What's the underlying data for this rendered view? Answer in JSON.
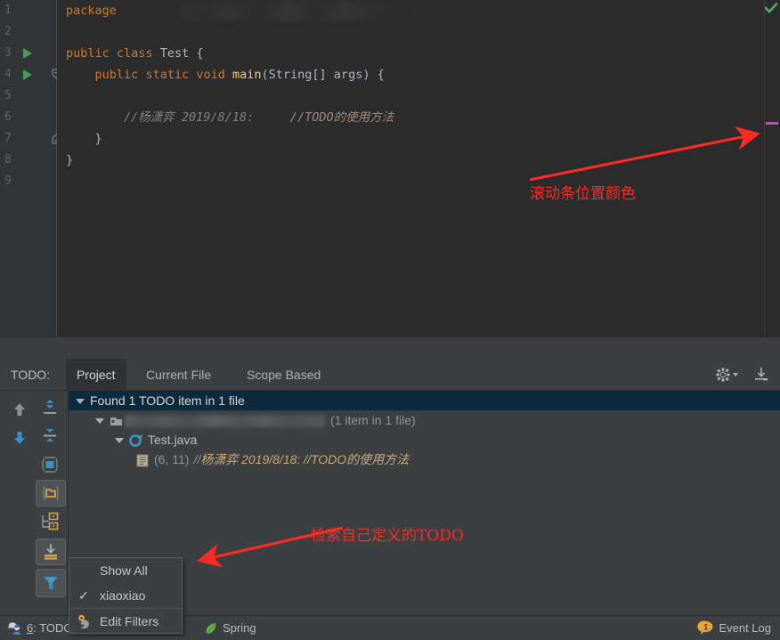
{
  "editor": {
    "line_numbers": [
      "1",
      "2",
      "3",
      "4",
      "5",
      "6",
      "7",
      "8",
      "9"
    ],
    "code": {
      "l1_package": "package",
      "l3": "public class Test {",
      "l3_kw1": "public",
      "l3_kw2": "class",
      "l3_name": "Test",
      "l3_brace": "{",
      "l4_kw1": "public",
      "l4_kw2": "static",
      "l4_kw3": "void",
      "l4_name": "main",
      "l4_args": "(String[] args) {",
      "l6_comment": "//杨潇弈 2019/8/18:",
      "l6_todo": "//TODO的使用方法",
      "l7": "}",
      "l8": "}"
    },
    "markers": {
      "inspection_ok_icon": "check-icon",
      "todo_stripe_color": "#cc44cc"
    }
  },
  "annotations": [
    {
      "text": "滚动条位置颜色",
      "color": "#ff2a24"
    },
    {
      "text": "检索自己定义的TODO",
      "color": "#ff2a24"
    }
  ],
  "todo_panel": {
    "label": "TODO:",
    "tabs": [
      {
        "label": "Project",
        "active": true
      },
      {
        "label": "Current File",
        "active": false
      },
      {
        "label": "Scope Based",
        "active": false
      }
    ],
    "header_buttons": [
      {
        "name": "settings-gear-button",
        "icon": "gear-icon"
      },
      {
        "name": "export-button",
        "icon": "export-to-file-icon"
      }
    ],
    "toolbar": [
      {
        "name": "previous-occurrence-button",
        "icon": "arrow-up-icon",
        "selected": false
      },
      {
        "name": "next-occurrence-button",
        "icon": "arrow-down-icon",
        "selected": false
      },
      {
        "name": "expand-all-button",
        "icon": "expand-all-icon",
        "selected": false
      },
      {
        "name": "collapse-all-button",
        "icon": "collapse-all-icon",
        "selected": false
      },
      {
        "name": "autoscroll-to-source-button",
        "icon": "autoscroll-source-icon",
        "selected": false
      },
      {
        "name": "group-by-modules-button",
        "icon": "folder-icon",
        "selected": true
      },
      {
        "name": "flatten-packages-button",
        "icon": "flatten-packages-icon",
        "selected": false
      },
      {
        "name": "group-by-packages-button",
        "icon": "group-packages-icon",
        "selected": true
      },
      {
        "name": "filter-todo-button",
        "icon": "filter-funnel-icon",
        "selected": true
      },
      {
        "name": "more-options-button",
        "icon": "chevron-right-right-icon",
        "selected": false
      }
    ],
    "toolbar_overflow": "»",
    "tree": {
      "root": "Found 1 TODO item in 1 file",
      "module_suffix": "(1 item in 1 file)",
      "file": "Test.java",
      "occurrence_location": "(6, 11)",
      "occurrence_slashes": "//",
      "occurrence_text": "杨潇弈 2019/8/18:   //TODO的使用方法"
    }
  },
  "context_menu": {
    "items": [
      {
        "label": "Show All",
        "checked": false,
        "icon": null
      },
      {
        "label": "xiaoxiao",
        "checked": true,
        "icon": null
      },
      {
        "label": "Edit Filters",
        "checked": false,
        "icon": "wrench-icon",
        "separator_above": true
      }
    ]
  },
  "status_bar": {
    "todo_button": "6: TODO",
    "todo_button_prefix": "6",
    "todo_button_suffix": ": TODO",
    "spring": "Spring",
    "event_log": "Event Log",
    "event_log_badge": "1"
  }
}
